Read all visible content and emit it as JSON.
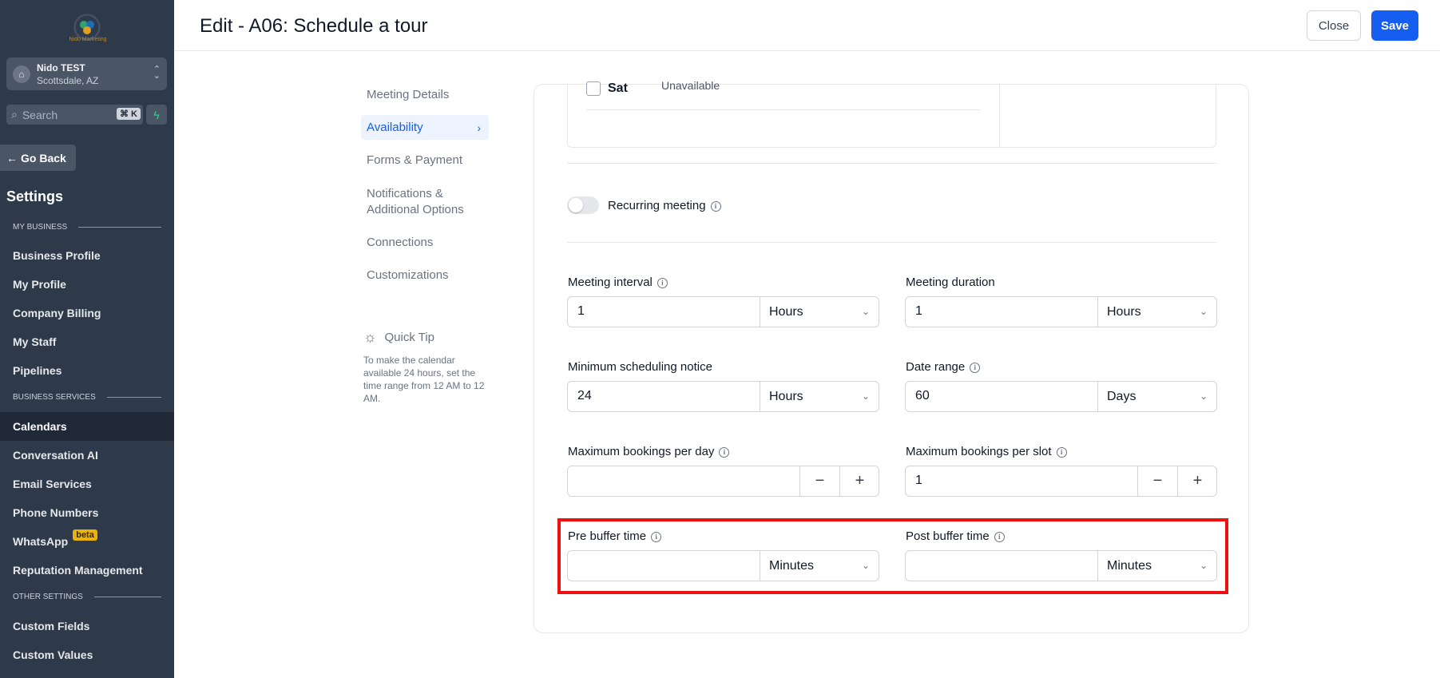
{
  "sidebar": {
    "logo_text": "Nido Marketing",
    "account": {
      "name": "Nido TEST",
      "location": "Scottsdale, AZ"
    },
    "search": {
      "placeholder": "Search",
      "shortcut": "⌘ K"
    },
    "go_back": "Go Back",
    "title": "Settings",
    "sections": {
      "my_business": "MY BUSINESS",
      "business_services": "BUSINESS SERVICES",
      "other_settings": "OTHER SETTINGS"
    },
    "items": {
      "business_profile": "Business Profile",
      "my_profile": "My Profile",
      "company_billing": "Company Billing",
      "my_staff": "My Staff",
      "pipelines": "Pipelines",
      "calendars": "Calendars",
      "conversation_ai": "Conversation AI",
      "email_services": "Email Services",
      "phone_numbers": "Phone Numbers",
      "whatsapp": "WhatsApp",
      "whatsapp_badge": "beta",
      "reputation": "Reputation Management",
      "custom_fields": "Custom Fields",
      "custom_values": "Custom Values"
    },
    "active_item": "Calendars"
  },
  "header": {
    "title": "Edit - A06: Schedule a tour",
    "close_label": "Close",
    "save_label": "Save"
  },
  "subnav": {
    "meeting_details": "Meeting Details",
    "availability": "Availability",
    "forms_payment": "Forms & Payment",
    "notif_1": "Notifications &",
    "notif_2": "Additional Options",
    "connections": "Connections",
    "customizations": "Customizations",
    "active": "Availability"
  },
  "quick_tip": {
    "title": "Quick Tip",
    "text": "To make the calendar available 24 hours, set the time range from 12 AM to 12 AM."
  },
  "form": {
    "schedule": {
      "day": "Sat",
      "status": "Unavailable",
      "checked": false
    },
    "recurring": {
      "label": "Recurring meeting",
      "enabled": false
    },
    "meeting_interval": {
      "label": "Meeting interval",
      "value": "1",
      "unit": "Hours"
    },
    "meeting_duration": {
      "label": "Meeting duration",
      "value": "1",
      "unit": "Hours"
    },
    "min_notice": {
      "label": "Minimum scheduling notice",
      "value": "24",
      "unit": "Hours"
    },
    "date_range": {
      "label": "Date range",
      "value": "60",
      "unit": "Days"
    },
    "max_per_day": {
      "label": "Maximum bookings per day",
      "value": ""
    },
    "max_per_slot": {
      "label": "Maximum bookings per slot",
      "value": "1"
    },
    "pre_buffer": {
      "label": "Pre buffer time",
      "value": "",
      "unit": "Minutes"
    },
    "post_buffer": {
      "label": "Post buffer time",
      "value": "",
      "unit": "Minutes"
    }
  },
  "colors": {
    "primary": "#155eef",
    "sidebar_bg": "#2e3a4a",
    "highlight": "#ee1111",
    "badge": "#eab308"
  }
}
